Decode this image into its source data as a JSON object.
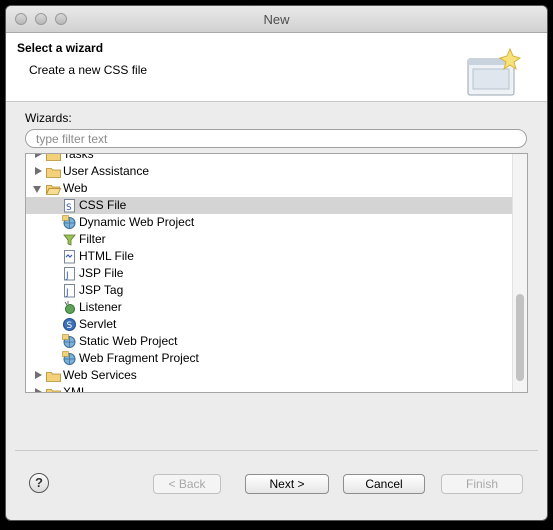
{
  "window": {
    "title": "New"
  },
  "header": {
    "title": "Select a wizard",
    "description": "Create a new CSS file"
  },
  "wizards_label": "Wizards:",
  "filter": {
    "placeholder": "type filter text",
    "value": ""
  },
  "tree": {
    "items": [
      {
        "label": "Tasks",
        "kind": "folder",
        "expanded": false,
        "icon": "folder-icon"
      },
      {
        "label": "User Assistance",
        "kind": "folder",
        "expanded": false,
        "icon": "folder-icon"
      },
      {
        "label": "Web",
        "kind": "folder",
        "expanded": true,
        "icon": "folder-open-icon"
      },
      {
        "label": "CSS File",
        "kind": "item",
        "selected": true,
        "icon": "css-file-icon"
      },
      {
        "label": "Dynamic Web Project",
        "kind": "item",
        "icon": "dynamic-web-project-icon"
      },
      {
        "label": "Filter",
        "kind": "item",
        "icon": "filter-icon"
      },
      {
        "label": "HTML File",
        "kind": "item",
        "icon": "html-file-icon"
      },
      {
        "label": "JSP File",
        "kind": "item",
        "icon": "jsp-file-icon"
      },
      {
        "label": "JSP Tag",
        "kind": "item",
        "icon": "jsp-tag-icon"
      },
      {
        "label": "Listener",
        "kind": "item",
        "icon": "listener-icon"
      },
      {
        "label": "Servlet",
        "kind": "item",
        "icon": "servlet-icon"
      },
      {
        "label": "Static Web Project",
        "kind": "item",
        "icon": "static-web-project-icon"
      },
      {
        "label": "Web Fragment Project",
        "kind": "item",
        "icon": "web-fragment-project-icon"
      },
      {
        "label": "Web Services",
        "kind": "folder",
        "expanded": false,
        "icon": "folder-icon"
      },
      {
        "label": "XML",
        "kind": "folder",
        "expanded": false,
        "icon": "folder-icon"
      }
    ]
  },
  "buttons": {
    "help": "?",
    "back": "< Back",
    "next": "Next >",
    "cancel": "Cancel",
    "finish": "Finish"
  },
  "colors": {
    "selection": "#d4d4d4",
    "folder": "#e2b64f",
    "file_blue": "#3a6fc4"
  }
}
